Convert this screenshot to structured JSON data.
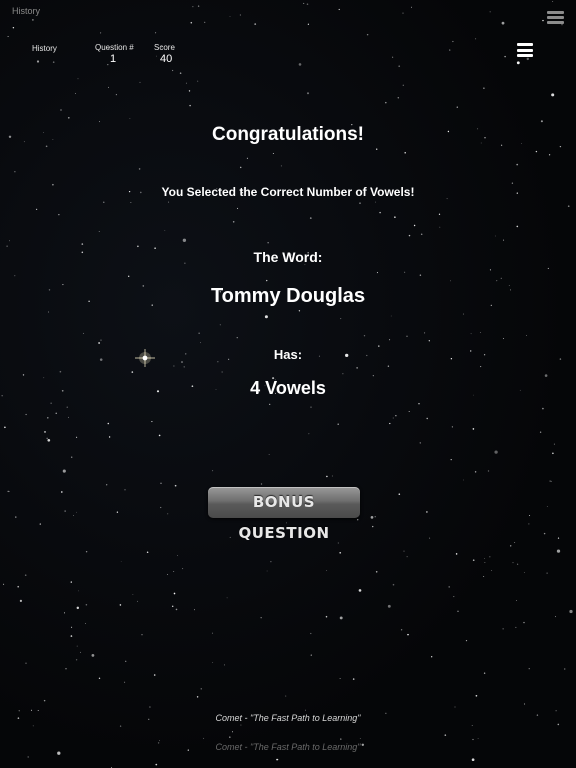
{
  "header": {
    "top_history": "History",
    "history_link": "History",
    "question_label": "Question #",
    "question_value": "1",
    "score_label": "Score",
    "score_value": "40",
    "menu_icon": "hamburger-menu-icon"
  },
  "result": {
    "title": "Congratulations!",
    "message": "You Selected the Correct Number of Vowels!",
    "word_label": "The Word:",
    "word": "Tommy Douglas",
    "has_label": "Has:",
    "vowel_count": "4 Vowels"
  },
  "actions": {
    "bonus_label": "BONUS QUESTION"
  },
  "footer": {
    "tagline": "Comet - \"The Fast Path to Learning\"",
    "tagline_faded": "Comet - \"The Fast Path to Learning\""
  }
}
